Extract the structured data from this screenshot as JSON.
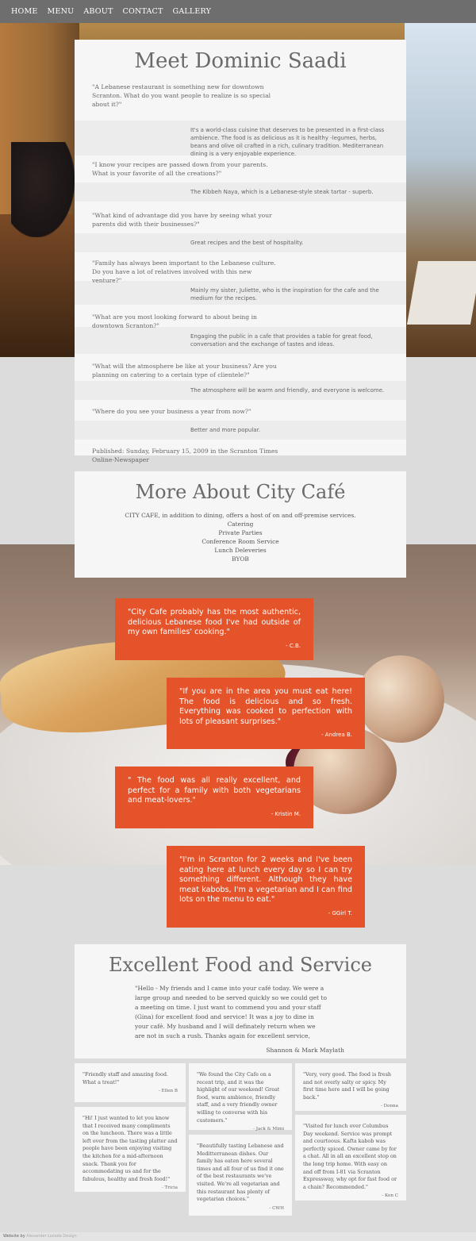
{
  "nav": {
    "items": [
      "HOME",
      "MENU",
      "ABOUT",
      "CONTACT",
      "GALLERY"
    ]
  },
  "interview": {
    "title": "Meet Dominic Saadi",
    "qa": [
      {
        "q": "\"A Lebanese restaurant is something new for downtown Scranton. What do you want people to realize is so special about it?\"",
        "a": "It's a world-class cuisine that deserves to be presented in a first-class ambience. The food is as delicious as it is healthy -legumes, herbs, beans and olive oil crafted in a rich, culinary tradition. Mediterranean dining is a very enjoyable experience."
      },
      {
        "q": "\"I know your recipes are passed down from your parents. What is your favorite of all the creations?\"",
        "a": "The Kibbeh Naya, which is a Lebanese-style steak tartar - superb."
      },
      {
        "q": "\"What kind of advantage did you have by seeing what your parents did with their businesses?\"",
        "a": "Great recipes and the best of hospitality."
      },
      {
        "q": "\"Family has always been important to the Lebanese culture. Do you have a lot of relatives involved with this new venture?\"",
        "a": "Mainly my sister, Juliette, who is the inspiration for the cafe and the medium for the recipes."
      },
      {
        "q": "\"What are you most looking forward to about being in downtown Scranton?\"",
        "a": "Engaging the public in a cafe that provides a table for great food, conversation and the exchange of tastes and ideas."
      },
      {
        "q": "\"What will the atmosphere be like at your business? Are you planning on catering to a certain type of clientele?\"",
        "a": "The atmosphere will be warm and friendly, and everyone is welcome."
      },
      {
        "q": "\"Where do you see your business a year from now?\"",
        "a": "Better and more popular."
      }
    ],
    "published": "Published: Sunday, February 15, 2009 in the Scranton Times Online-Newspaper"
  },
  "about": {
    "title": "More About City Café",
    "lines": [
      "CITY CAFE, in addition to dining, offers a host of on and off-premise services.",
      "Catering",
      "Private Parties",
      "Conference Room Service",
      "Lunch Deleveries",
      "BYOB"
    ]
  },
  "testimonials": [
    {
      "text": "\"City Cafe probably has the most authentic, delicious Lebanese food I've had outside of my own families' cooking.\"",
      "by": "- C.B."
    },
    {
      "text": "\"If you are in the area you must eat here! The food is delicious and so fresh. Everything was cooked to perfection with lots of pleasant surprises.\"",
      "by": "- Andrea B."
    },
    {
      "text": "\" The food was all really excellent, and perfect for a family with both vegetarians and meat-lovers.\"",
      "by": "- Kristin M."
    },
    {
      "text": "\"I'm in Scranton for 2 weeks and I've been eating here at lunch every day so I can try something different. Although they have meat kabobs, I'm a vegetarian and I can find lots on the menu to eat.\"",
      "by": "- GGirl T."
    }
  ],
  "excellent": {
    "title": "Excellent Food and Service",
    "body": "\"Hello - My friends and I came into your café today. We were a large group and needed to be served quickly so we could get to a meeting on time. I just want to commend you and your staff (Gina) for excellent food and service! It was a joy to dine in your café. My husband and I will definately return when we are not in such a rush. Thanks again for excellent service,",
    "signature": "Shannon & Mark Maylath"
  },
  "reviews": [
    {
      "text": "\"Friendly staff and amazing food. What a treat!\"",
      "by": "- Ellen B"
    },
    {
      "text": "\"Hi! I just wanted to let you know that I received many compliments on the luncheon. There was a little left over from the tasting platter and people have been enjoying visiting the kitchen for a mid-afternoon snack. Thank you for accommodating us and for the fabulous, healthy and fresh food!\"",
      "by": "- Tricia"
    },
    {
      "text": "\"We found the City Cafe on a recent trip, and it was the highlight of our weekend! Great food, warm ambience, friendly staff, and a very friendly owner willing to converse with his customers.\"",
      "by": "- Jack & Mimi"
    },
    {
      "text": "\"Beautifully tasting Lebanese and Meditterranean dishes. Our family has eaten here several times and all four of us find it one of the best restaurants we've visited. We're all vegetarian and this restaurant has plenty of vegetarian choices.\"",
      "by": "- CWH"
    },
    {
      "text": "\"Very, very good. The food is fresh and not overly salty or spicy. My first time here and I will be going back.\"",
      "by": "- Donna"
    },
    {
      "text": "\"Visited for lunch over Columbus Day weekend. Service was prompt and courteous. Kafta kabob was perfectly spiced. Owner came by for a chat. All in all an excellent stop on the long trip home. With easy on and off from I-81 via Scranton Expressway, why opt for fast food or a chain? Recommended.\"",
      "by": "- Ken C"
    }
  ],
  "footer": {
    "prefix": "Website by",
    "name": "Alexander Lozada Design"
  }
}
